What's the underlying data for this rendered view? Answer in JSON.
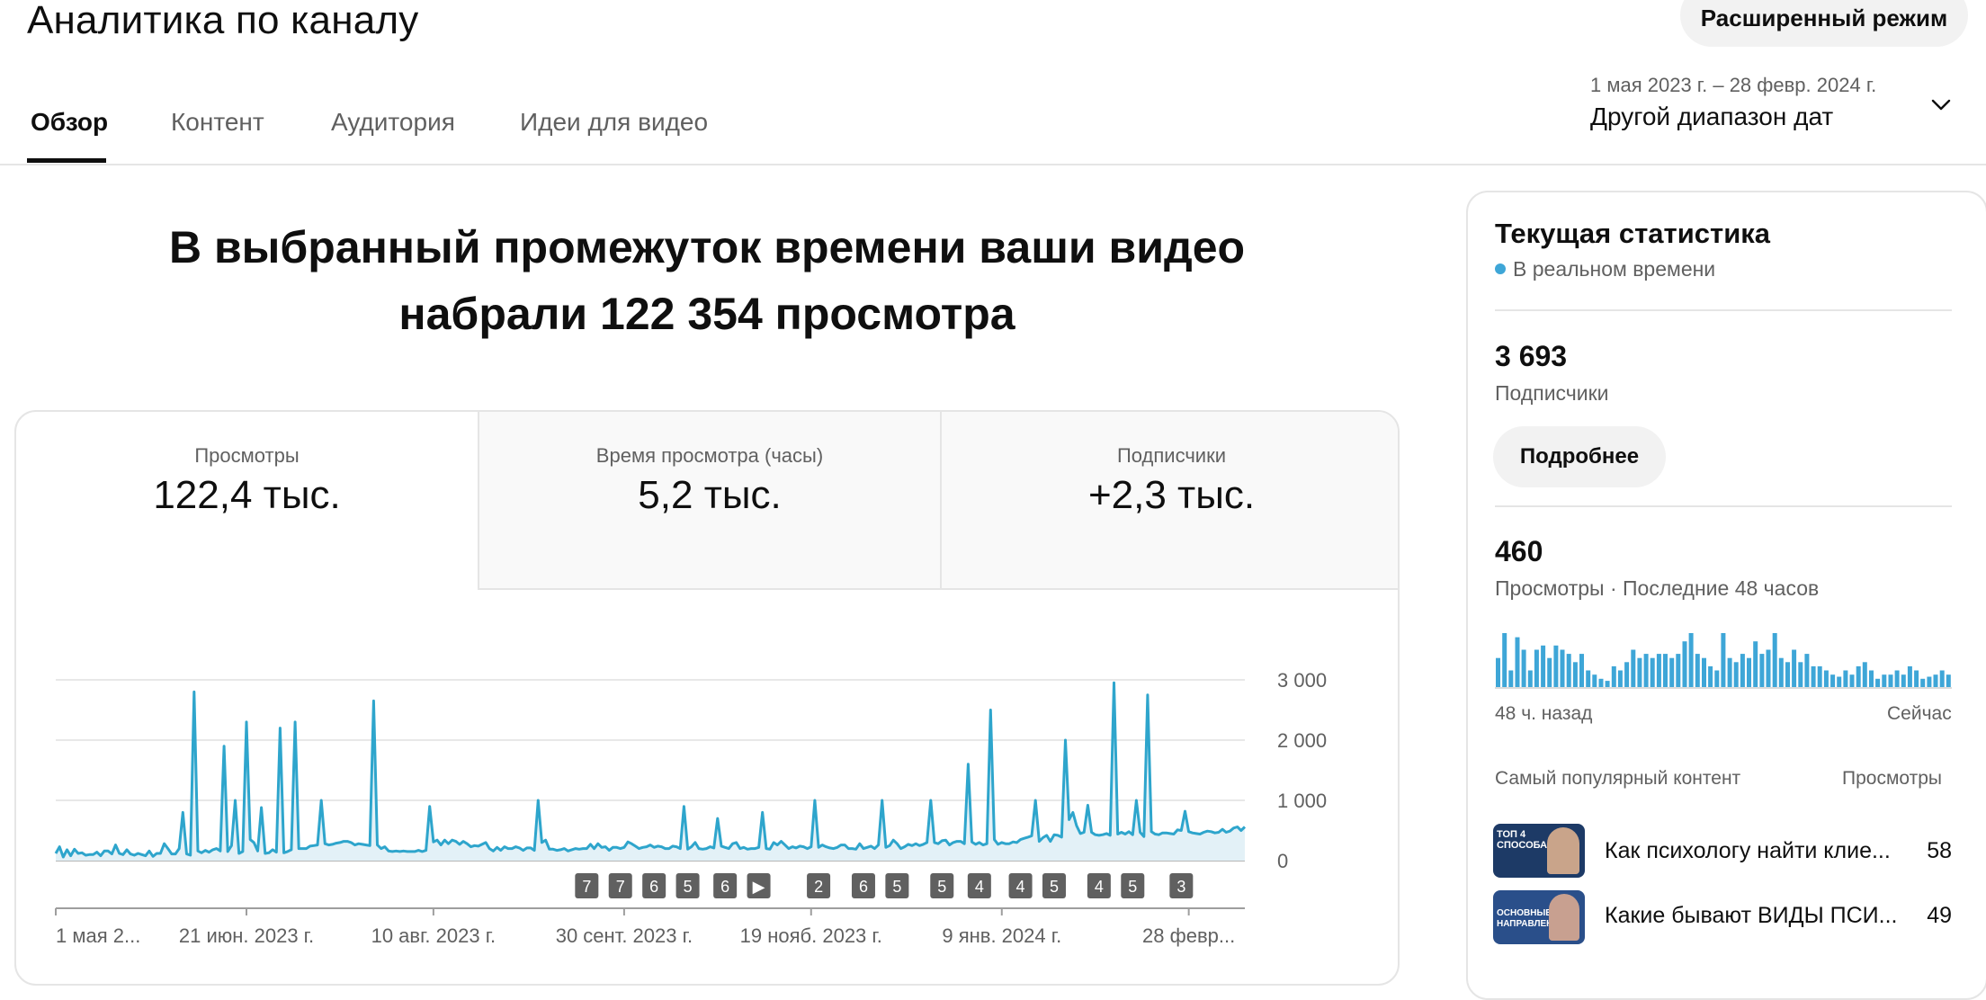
{
  "header": {
    "title": "Аналитика по каналу",
    "advanced_button": "Расширенный режим",
    "date_range_sub": "1 мая 2023 г. – 28 февр. 2024 г.",
    "date_range_label": "Другой диапазон дат"
  },
  "tabs": [
    {
      "label": "Обзор",
      "active": true
    },
    {
      "label": "Контент",
      "active": false
    },
    {
      "label": "Аудитория",
      "active": false
    },
    {
      "label": "Идеи для видео",
      "active": false
    }
  ],
  "headline": {
    "line1": "В выбранный промежуток времени ваши видео",
    "line2": "набрали 122 354 просмотра"
  },
  "metrics": [
    {
      "label": "Просмотры",
      "value": "122,4 тыс."
    },
    {
      "label": "Время просмотра (часы)",
      "value": "5,2 тыс."
    },
    {
      "label": "Подписчики",
      "value": "+2,3 тыс."
    }
  ],
  "colors": {
    "accent": "#3ea6d7",
    "line": "#2ea5cc",
    "fill": "#e3f1f7",
    "badge": "#606060"
  },
  "chart_data": {
    "type": "area",
    "ylim": [
      0,
      3000
    ],
    "yticks": [
      0,
      1000,
      2000,
      3000
    ],
    "ytick_labels": [
      "0",
      "1 000",
      "2 000",
      "3 000"
    ],
    "xticks": [
      {
        "label": "1 мая 2...",
        "day": 0
      },
      {
        "label": "21 июн. 2023 г.",
        "day": 51
      },
      {
        "label": "10 авг. 2023 г.",
        "day": 101
      },
      {
        "label": "30 сент. 2023 г.",
        "day": 152
      },
      {
        "label": "19 нояб. 2023 г.",
        "day": 202
      },
      {
        "label": "9 янв. 2024 г.",
        "day": 253
      },
      {
        "label": "28 февр...",
        "day": 303
      }
    ],
    "series": [
      {
        "values": [
          120,
          230,
          60,
          180,
          80,
          190,
          120,
          130,
          90,
          100,
          100,
          140,
          80,
          160,
          160,
          110,
          260,
          120,
          100,
          180,
          110,
          90,
          120,
          100,
          80,
          160,
          70,
          120,
          120,
          280,
          200,
          110,
          110,
          200,
          120,
          110,
          90,
          100,
          160,
          130,
          170,
          140,
          180,
          200,
          160,
          130,
          150,
          250,
          320,
          120,
          150,
          230,
          350,
          300,
          160,
          170,
          120,
          130,
          180,
          140,
          140,
          130,
          150,
          180,
          110,
          200,
          200,
          200,
          240,
          250,
          260,
          270,
          280,
          260,
          270,
          290,
          300,
          320,
          320,
          300,
          260,
          280,
          270,
          260,
          250,
          230,
          260,
          200,
          230,
          160,
          150,
          160,
          150,
          160,
          150,
          150,
          150,
          170,
          150,
          170,
          300,
          310,
          340,
          260,
          340,
          280,
          340,
          320,
          270,
          320,
          280,
          230,
          250,
          240,
          270,
          300,
          200,
          160,
          220,
          170,
          230,
          200,
          200,
          230,
          210,
          170,
          210,
          210,
          170,
          290,
          300,
          340,
          190,
          190,
          170,
          180,
          200,
          160,
          180,
          200,
          190,
          200,
          200,
          270,
          200,
          280,
          220,
          230,
          170,
          220,
          220,
          200,
          220,
          310,
          280,
          240,
          200,
          220,
          230,
          260,
          220,
          240,
          230,
          200,
          200,
          240,
          230,
          200,
          280,
          190,
          230,
          300,
          200,
          190,
          200,
          230,
          210,
          200,
          240,
          220,
          200,
          280,
          300,
          200,
          220,
          190,
          200,
          200,
          220,
          220,
          200,
          190,
          300,
          260,
          320,
          260,
          200,
          230,
          210,
          240,
          230,
          200,
          230,
          200,
          220,
          260,
          230,
          210,
          200,
          220,
          260,
          260,
          200,
          200,
          190,
          280,
          200,
          220,
          240,
          200,
          260,
          250,
          220,
          250,
          340,
          280,
          200,
          230,
          270,
          250,
          280,
          250,
          270,
          300,
          320,
          300,
          280,
          330,
          340,
          260,
          300,
          320,
          320,
          280,
          300,
          310,
          270,
          300,
          260,
          280,
          330,
          350,
          270,
          300,
          280,
          280,
          310,
          300,
          350,
          370,
          390,
          410,
          400,
          320,
          380,
          420,
          320,
          430,
          420,
          390,
          500,
          680,
          800,
          580,
          450,
          470,
          490,
          470,
          430,
          420,
          430,
          450,
          420,
          420,
          440,
          470,
          440,
          480,
          430,
          450,
          470,
          400,
          470,
          480,
          440,
          430,
          460,
          460,
          450,
          440,
          510,
          500,
          480,
          480,
          460,
          450,
          440,
          470,
          490,
          480,
          460,
          470,
          520,
          470,
          490,
          540,
          560,
          500,
          560
        ],
        "spikes": {
          "34": 800,
          "37": 2800,
          "45": 1900,
          "48": 1000,
          "51": 2300,
          "55": 880,
          "60": 2200,
          "64": 2300,
          "71": 1000,
          "85": 2650,
          "100": 900,
          "129": 1000,
          "168": 900,
          "177": 700,
          "189": 800,
          "203": 1000,
          "221": 1000,
          "234": 1000,
          "244": 1600,
          "250": 2500,
          "262": 1000,
          "270": 2000,
          "276": 920,
          "283": 2950,
          "289": 1000,
          "292": 2750,
          "302": 820
        }
      }
    ],
    "badges": [
      {
        "label": "7",
        "day": 142
      },
      {
        "label": "7",
        "day": 151
      },
      {
        "label": "6",
        "day": 160
      },
      {
        "label": "5",
        "day": 169
      },
      {
        "label": "6",
        "day": 179
      },
      {
        "label": "▶",
        "day": 188
      },
      {
        "label": "2",
        "day": 204
      },
      {
        "label": "6",
        "day": 216
      },
      {
        "label": "5",
        "day": 225
      },
      {
        "label": "5",
        "day": 237
      },
      {
        "label": "4",
        "day": 247
      },
      {
        "label": "4",
        "day": 258
      },
      {
        "label": "5",
        "day": 267
      },
      {
        "label": "4",
        "day": 279
      },
      {
        "label": "5",
        "day": 288
      },
      {
        "label": "3",
        "day": 301
      }
    ]
  },
  "side": {
    "title": "Текущая статистика",
    "realtime": "В реальном времени",
    "subscribers_value": "3 693",
    "subscribers_label": "Подписчики",
    "more_button": "Подробнее",
    "views_value": "460",
    "views_label": "Просмотры · Последние 48 часов",
    "spark_left": "48 ч. назад",
    "spark_right": "Сейчас",
    "spark_values": [
      14,
      26,
      8,
      24,
      18,
      8,
      18,
      20,
      14,
      20,
      18,
      16,
      12,
      16,
      8,
      6,
      4,
      3,
      10,
      8,
      12,
      18,
      14,
      16,
      14,
      16,
      16,
      14,
      16,
      22,
      26,
      16,
      14,
      10,
      8,
      26,
      14,
      12,
      16,
      14,
      22,
      16,
      18,
      26,
      14,
      12,
      18,
      12,
      16,
      10,
      10,
      8,
      6,
      5,
      8,
      6,
      10,
      12,
      8,
      4,
      6,
      6,
      8,
      6,
      10,
      8,
      4,
      5,
      6,
      8,
      6
    ],
    "popular_header": "Самый популярный контент",
    "popular_views_header": "Просмотры",
    "popular": [
      {
        "title": "Как психологу найти клие...",
        "views": "58",
        "thumb_text": [
          "ТОП 4",
          "СПОСОБА"
        ]
      },
      {
        "title": "Какие бывают ВИДЫ ПСИ...",
        "views": "49",
        "thumb_text": [
          "ОСНОВНЫЕ",
          "НАПРАВЛЕНИЯ"
        ]
      }
    ]
  }
}
